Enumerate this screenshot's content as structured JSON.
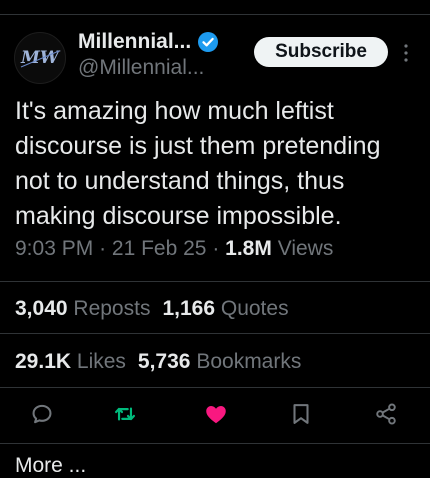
{
  "post": {
    "display_name": "Millennial...",
    "handle": "@Millennial...",
    "avatar_text": "MW",
    "subscribe_label": "Subscribe",
    "text": "It's amazing how much leftist discourse is just them pretending not to understand things, thus making discourse impossible.",
    "time": "9:03 PM",
    "separator": "·",
    "date": "21 Feb 25",
    "views_count": "1.8M",
    "views_label": "Views"
  },
  "stats": {
    "reposts_count": "3,040",
    "reposts_label": "Reposts",
    "quotes_count": "1,166",
    "quotes_label": "Quotes",
    "likes_count": "29.1K",
    "likes_label": "Likes",
    "bookmarks_count": "5,736",
    "bookmarks_label": "Bookmarks"
  },
  "actions": [
    "reply-icon",
    "repost-icon",
    "like-icon",
    "bookmark-icon",
    "share-icon"
  ],
  "colors": {
    "background": "#000000",
    "text": "#e7e9ea",
    "secondary": "#71767b",
    "divider": "#2f3336",
    "verified": "#1d9bf0",
    "repost_active": "#00ba7c",
    "like_active": "#f91880"
  },
  "footer": {
    "text": "More ..."
  }
}
